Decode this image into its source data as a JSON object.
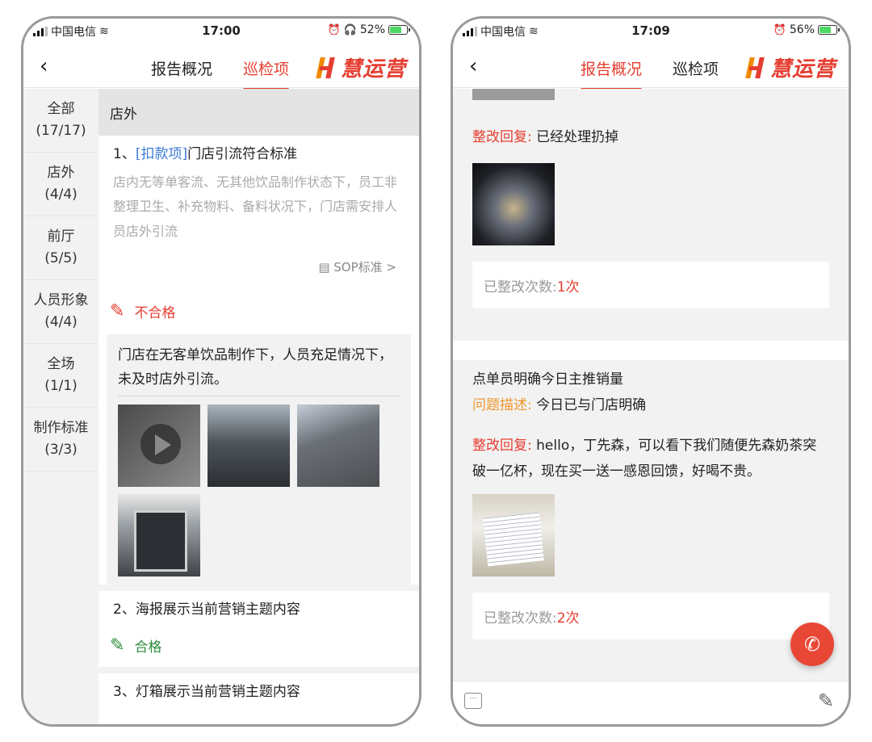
{
  "left": {
    "status": {
      "carrier": "中国电信",
      "time": "17:00",
      "battery": "52%"
    },
    "nav": {
      "tab_report": "报告概况",
      "tab_check": "巡检项",
      "active_tab": "巡检项",
      "logo_text": "慧运营"
    },
    "sidebar": [
      {
        "label": "全部",
        "count": "(17/17)"
      },
      {
        "label": "店外",
        "count": "(4/4)"
      },
      {
        "label": "前厅",
        "count": "(5/5)"
      },
      {
        "label": "人员形象",
        "count": "(4/4)"
      },
      {
        "label": "全场",
        "count": "(1/1)"
      },
      {
        "label": "制作标准",
        "count": "(3/3)"
      }
    ],
    "section_title": "店外",
    "item1": {
      "prefix": "1、",
      "tag": "[扣款项]",
      "title": "门店引流符合标准",
      "description": "店内无等单客流、无其他饮品制作状态下，员工非整理卫生、补充物料、备料状况下，门店需安排人员店外引流",
      "sop_label": "SOP标准 >",
      "result": "不合格",
      "issue": "门店在无客单饮品制作下，人员充足情况下，未及时店外引流。"
    },
    "item2": {
      "title": "2、海报展示当前营销主题内容",
      "result": "合格"
    },
    "item3": {
      "title": "3、灯箱展示当前营销主题内容"
    }
  },
  "right": {
    "status": {
      "carrier": "中国电信",
      "time": "17:09",
      "battery": "56%"
    },
    "nav": {
      "tab_report": "报告概况",
      "tab_check": "巡检项",
      "active_tab": "报告概况",
      "logo_text": "慧运营"
    },
    "card1": {
      "reply_label": "整改回复:",
      "reply_text": "已经处理扔掉",
      "count_label": "已整改次数:",
      "count_value": "1次"
    },
    "card2": {
      "title": "点单员明确今日主推销量",
      "desc_label": "问题描述:",
      "desc_text": "今日已与门店明确",
      "reply_label": "整改回复:",
      "reply_text": "hello，丁先森，可以看下我们随便先森奶茶突破一亿杯，现在买一送一感恩回馈，好喝不贵。",
      "count_label": "已整改次数:",
      "count_value": "2次"
    }
  },
  "colors": {
    "accent": "#e53d30",
    "pass": "#2e8b3e",
    "link": "#3a7bd5",
    "orange": "#f0962b"
  }
}
